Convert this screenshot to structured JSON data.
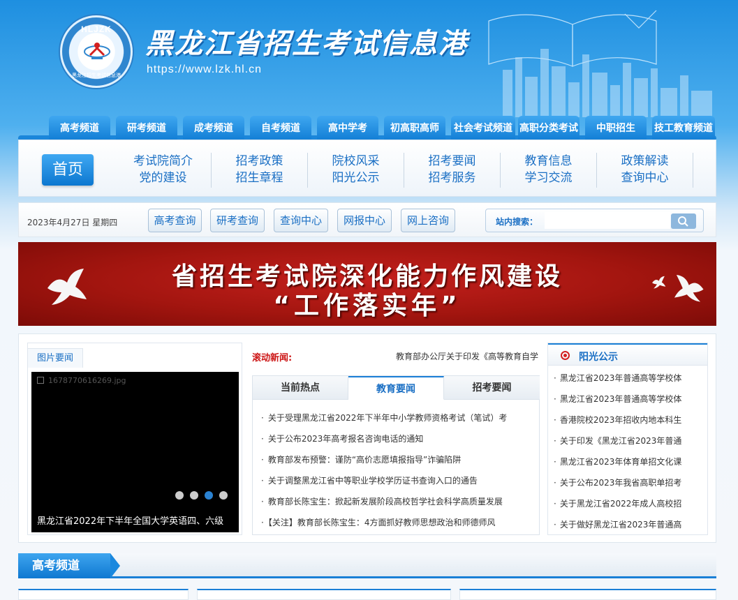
{
  "header": {
    "logo_abbr": "HLJZK",
    "logo_ring_text": "黑龙江招生考试信息港",
    "site_title": "黑龙江省招生考试信息港",
    "site_url": "https://www.lzk.hl.cn"
  },
  "channels": [
    "高考频道",
    "研考频道",
    "成考频道",
    "自考频道",
    "高中学考",
    "初高职高师",
    "社会考试频道",
    "高职分类考试",
    "中职招生",
    "技工教育频道"
  ],
  "main_nav": {
    "home": "首页",
    "groups": [
      [
        "考试院简介",
        "党的建设"
      ],
      [
        "招考政策",
        "招生章程"
      ],
      [
        "院校风采",
        "阳光公示"
      ],
      [
        "招考要闻",
        "招考服务"
      ],
      [
        "教育信息",
        "学习交流"
      ],
      [
        "政策解读",
        "查询中心"
      ]
    ]
  },
  "quick_bar": {
    "date": "2023年4月27日 星期四",
    "buttons": [
      "高考查询",
      "研考查询",
      "查询中心",
      "网报中心",
      "网上咨询"
    ],
    "search_label": "站内搜索：",
    "search_value": ""
  },
  "banner": {
    "line1": "省招生考试院深化能力作风建设",
    "line2": "“工作落实年”"
  },
  "pic_news": {
    "tab": "图片要闻",
    "broken_image_name": "1678770616269.jpg",
    "caption": "黑龙江省2022年下半年全国大学英语四、六级",
    "dots": 4,
    "active_dot": 3
  },
  "middle": {
    "rolling_label": "滚动新闻:",
    "rolling_text": "教育部办公厅关于印发《高等教育自学",
    "tabs": [
      "当前热点",
      "教育要闻",
      "招考要闻"
    ],
    "active_tab": 1,
    "news": [
      "关于受理黑龙江省2022年下半年中小学教师资格考试（笔试）考",
      "关于公布2023年高考报名咨询电话的通知",
      "教育部发布预警：谨防“高价志愿填报指导”诈骗陷阱",
      "关于调整黑龙江省中等职业学校学历证书查询入口的通告",
      "教育部长陈宝生：掀起新发展阶段高校哲学社会科学高质量发展",
      "【关注】教育部长陈宝生：4方面抓好教师思想政治和师德师风"
    ]
  },
  "right": {
    "title": "阳光公示",
    "items": [
      "黑龙江省2023年普通高等学校体",
      "黑龙江省2023年普通高等学校体",
      "香港院校2023年招收内地本科生",
      "关于印发《黑龙江省2023年普通",
      "黑龙江省2023年体育单招文化课",
      "关于公布2023年我省高职单招考",
      "关于黑龙江省2022年成人高校招",
      "关于做好黑龙江省2023年普通高"
    ]
  },
  "section": {
    "title": "高考频道"
  },
  "colors": {
    "primary_blue": "#1a7fd6",
    "link_blue": "#1a6fc4",
    "banner_red": "#a2150f",
    "rolling_red": "#cc1515"
  }
}
